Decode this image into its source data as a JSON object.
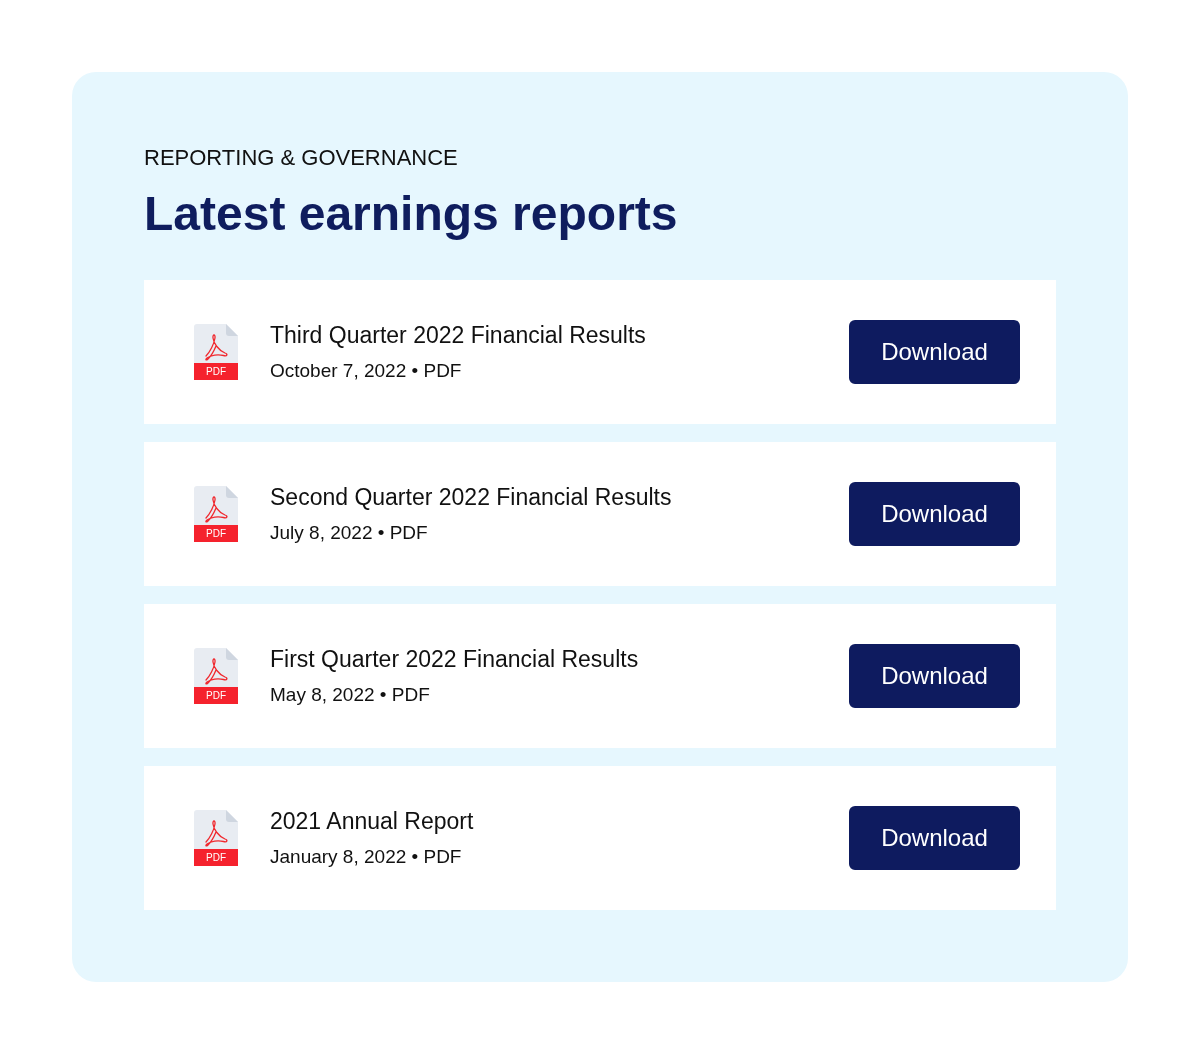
{
  "header": {
    "eyebrow": "REPORTING & GOVERNANCE",
    "title": "Latest earnings reports"
  },
  "reports": [
    {
      "title": "Third Quarter 2022 Financial Results",
      "meta": "October 7, 2022 • PDF",
      "file_type": "PDF",
      "button": "Download"
    },
    {
      "title": "Second Quarter 2022 Financial Results",
      "meta": "July 8, 2022 • PDF",
      "file_type": "PDF",
      "button": "Download"
    },
    {
      "title": "First Quarter 2022 Financial Results",
      "meta": "May 8, 2022 • PDF",
      "file_type": "PDF",
      "button": "Download"
    },
    {
      "title": "2021 Annual Report",
      "meta": "January 8, 2022 • PDF",
      "file_type": "PDF",
      "button": "Download"
    }
  ]
}
